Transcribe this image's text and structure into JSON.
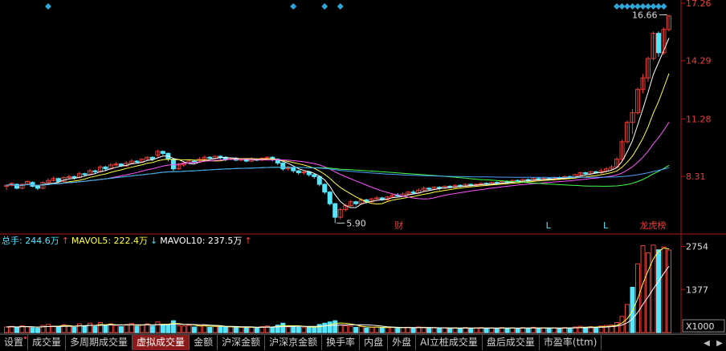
{
  "price_axis": {
    "ticks": [
      "17.26",
      "14.29",
      "11.28",
      "8.31"
    ]
  },
  "volume_axis": {
    "ticks": [
      "2754",
      "1377"
    ],
    "unit": "X1000"
  },
  "annotations": {
    "high_price": "16.66",
    "low_price": "5.90",
    "event_markers": [
      "财",
      "L",
      "L",
      "龙虎榜"
    ]
  },
  "volume_indicator": {
    "total_label": "总手: 244.6万",
    "mavol5_label": "MAVOL5: 222.4万",
    "mavol10_label": "MAVOL10: 237.5万"
  },
  "tabs": [
    {
      "label": "设置"
    },
    {
      "label": "成交量"
    },
    {
      "label": "多周期成交量"
    },
    {
      "label": "虚拟成交量"
    },
    {
      "label": "金额"
    },
    {
      "label": "沪深金额"
    },
    {
      "label": "沪深京金额"
    },
    {
      "label": "换手率"
    },
    {
      "label": "内盘"
    },
    {
      "label": "外盘"
    },
    {
      "label": "AI立桩成交量"
    },
    {
      "label": "盘后成交量"
    },
    {
      "label": "市盈率(ttm)"
    }
  ],
  "active_tab": "虚拟成交量",
  "colors": {
    "up": "#e8403a",
    "down": "#55e6ff",
    "axis": "#b01818",
    "ma5": "#ffffff",
    "ma10": "#ffff44",
    "ma20": "#ff55ff",
    "ma60": "#44ff44",
    "ma120": "#4aa3ff",
    "marker": "#2fa6d8"
  },
  "chart_data": {
    "type": "candlestick",
    "ylim": [
      5.5,
      17.26
    ],
    "volume_ylim": [
      0,
      3000
    ],
    "candles": [
      [
        7.8,
        7.85,
        7.6,
        7.9
      ],
      [
        7.85,
        7.95,
        7.8,
        8.0
      ],
      [
        7.9,
        7.7,
        7.65,
        7.95
      ],
      [
        7.7,
        7.9,
        7.65,
        7.95
      ],
      [
        7.9,
        8.05,
        7.85,
        8.1
      ],
      [
        8.0,
        7.8,
        7.75,
        8.05
      ],
      [
        7.8,
        7.7,
        7.6,
        7.85
      ],
      [
        7.7,
        8.0,
        7.65,
        8.05
      ],
      [
        8.0,
        8.1,
        7.95,
        8.2
      ],
      [
        8.1,
        8.2,
        8.05,
        8.3
      ],
      [
        8.2,
        8.05,
        8.0,
        8.25
      ],
      [
        8.05,
        8.25,
        8.0,
        8.3
      ],
      [
        8.25,
        8.3,
        8.2,
        8.4
      ],
      [
        8.3,
        8.25,
        8.15,
        8.35
      ],
      [
        8.25,
        8.45,
        8.2,
        8.55
      ],
      [
        8.45,
        8.4,
        8.3,
        8.5
      ],
      [
        8.4,
        8.6,
        8.35,
        8.7
      ],
      [
        8.6,
        8.55,
        8.45,
        8.65
      ],
      [
        8.55,
        8.8,
        8.5,
        8.9
      ],
      [
        8.8,
        8.7,
        8.6,
        8.85
      ],
      [
        8.7,
        8.9,
        8.65,
        9.0
      ],
      [
        8.9,
        8.95,
        8.85,
        9.05
      ],
      [
        8.95,
        8.85,
        8.8,
        9.0
      ],
      [
        8.85,
        9.0,
        8.8,
        9.1
      ],
      [
        9.0,
        9.1,
        8.95,
        9.2
      ],
      [
        9.1,
        9.05,
        9.0,
        9.15
      ],
      [
        9.05,
        9.2,
        9.0,
        9.25
      ],
      [
        9.2,
        9.3,
        9.15,
        9.35
      ],
      [
        9.3,
        9.2,
        9.1,
        9.35
      ],
      [
        9.4,
        9.6,
        9.3,
        9.7
      ],
      [
        9.6,
        9.5,
        9.4,
        9.65
      ],
      [
        9.5,
        9.2,
        9.1,
        9.55
      ],
      [
        9.2,
        8.7,
        8.6,
        9.25
      ],
      [
        8.7,
        8.9,
        8.65,
        9.0
      ],
      [
        8.9,
        9.0,
        8.8,
        9.1
      ],
      [
        9.0,
        9.1,
        8.95,
        9.2
      ],
      [
        9.1,
        9.05,
        8.95,
        9.15
      ],
      [
        9.05,
        9.2,
        9.0,
        9.3
      ],
      [
        9.2,
        9.3,
        9.15,
        9.4
      ],
      [
        9.3,
        9.25,
        9.2,
        9.35
      ],
      [
        9.25,
        9.35,
        9.2,
        9.4
      ],
      [
        9.35,
        9.3,
        9.2,
        9.4
      ],
      [
        9.3,
        9.2,
        9.1,
        9.35
      ],
      [
        9.2,
        9.25,
        9.15,
        9.3
      ],
      [
        9.25,
        9.15,
        9.1,
        9.3
      ],
      [
        9.15,
        9.2,
        9.1,
        9.25
      ],
      [
        9.2,
        9.1,
        9.05,
        9.25
      ],
      [
        9.1,
        9.2,
        9.05,
        9.3
      ],
      [
        9.2,
        9.15,
        9.1,
        9.25
      ],
      [
        9.15,
        9.25,
        9.1,
        9.3
      ],
      [
        9.25,
        9.3,
        9.2,
        9.35
      ],
      [
        9.3,
        9.2,
        9.1,
        9.35
      ],
      [
        9.2,
        9.0,
        8.9,
        9.25
      ],
      [
        9.0,
        8.7,
        8.6,
        9.05
      ],
      [
        8.7,
        8.75,
        8.6,
        8.85
      ],
      [
        8.75,
        8.6,
        8.5,
        8.8
      ],
      [
        8.6,
        8.5,
        8.4,
        8.65
      ],
      [
        8.5,
        8.55,
        8.4,
        8.6
      ],
      [
        8.55,
        8.4,
        8.3,
        8.6
      ],
      [
        8.4,
        8.3,
        8.2,
        8.45
      ],
      [
        8.3,
        7.9,
        7.8,
        8.35
      ],
      [
        7.9,
        7.5,
        7.4,
        7.95
      ],
      [
        7.5,
        6.9,
        6.8,
        7.55
      ],
      [
        6.9,
        6.2,
        5.9,
        6.95
      ],
      [
        6.2,
        6.6,
        6.1,
        6.7
      ],
      [
        6.6,
        6.8,
        6.5,
        6.9
      ],
      [
        6.8,
        7.0,
        6.75,
        7.1
      ],
      [
        7.0,
        6.9,
        6.8,
        7.05
      ],
      [
        6.9,
        7.1,
        6.85,
        7.2
      ],
      [
        7.1,
        7.0,
        6.9,
        7.15
      ],
      [
        7.0,
        7.15,
        6.95,
        7.2
      ],
      [
        7.15,
        7.2,
        7.1,
        7.3
      ],
      [
        7.2,
        7.1,
        7.05,
        7.25
      ],
      [
        7.1,
        7.25,
        7.05,
        7.3
      ],
      [
        7.25,
        7.35,
        7.2,
        7.4
      ],
      [
        7.35,
        7.3,
        7.25,
        7.45
      ],
      [
        7.3,
        7.4,
        7.25,
        7.5
      ],
      [
        7.4,
        7.5,
        7.35,
        7.55
      ],
      [
        7.5,
        7.45,
        7.4,
        7.6
      ],
      [
        7.45,
        7.6,
        7.4,
        7.7
      ],
      [
        7.6,
        7.7,
        7.55,
        7.8
      ],
      [
        7.7,
        7.65,
        7.6,
        7.75
      ],
      [
        7.65,
        7.75,
        7.6,
        7.8
      ],
      [
        7.75,
        7.7,
        7.6,
        7.8
      ],
      [
        7.7,
        7.8,
        7.65,
        7.85
      ],
      [
        7.8,
        7.75,
        7.7,
        7.85
      ],
      [
        7.75,
        7.85,
        7.7,
        7.9
      ],
      [
        7.85,
        7.8,
        7.75,
        7.9
      ],
      [
        7.8,
        7.9,
        7.75,
        7.95
      ],
      [
        7.9,
        7.85,
        7.8,
        7.95
      ],
      [
        7.85,
        7.9,
        7.8,
        7.95
      ],
      [
        7.9,
        7.95,
        7.85,
        8.0
      ],
      [
        7.95,
        7.9,
        7.85,
        8.0
      ],
      [
        7.9,
        8.0,
        7.85,
        8.05
      ],
      [
        8.0,
        7.95,
        7.9,
        8.05
      ],
      [
        7.95,
        8.05,
        7.9,
        8.1
      ],
      [
        8.05,
        8.0,
        7.95,
        8.1
      ],
      [
        8.0,
        8.1,
        7.95,
        8.15
      ],
      [
        8.1,
        8.05,
        8.0,
        8.15
      ],
      [
        8.05,
        8.15,
        8.0,
        8.2
      ],
      [
        8.15,
        8.1,
        8.05,
        8.2
      ],
      [
        8.1,
        8.2,
        8.05,
        8.25
      ],
      [
        8.2,
        8.15,
        8.1,
        8.25
      ],
      [
        8.15,
        8.2,
        8.1,
        8.25
      ],
      [
        8.2,
        8.15,
        8.1,
        8.25
      ],
      [
        8.15,
        8.25,
        8.1,
        8.3
      ],
      [
        8.25,
        8.2,
        8.15,
        8.3
      ],
      [
        8.2,
        8.3,
        8.15,
        8.35
      ],
      [
        8.3,
        8.25,
        8.2,
        8.35
      ],
      [
        8.25,
        8.4,
        8.2,
        8.45
      ],
      [
        8.4,
        8.5,
        8.35,
        8.55
      ],
      [
        8.5,
        8.45,
        8.4,
        8.55
      ],
      [
        8.45,
        8.55,
        8.4,
        8.6
      ],
      [
        8.55,
        8.5,
        8.45,
        8.6
      ],
      [
        8.5,
        8.6,
        8.45,
        8.7
      ],
      [
        8.6,
        8.7,
        8.55,
        8.8
      ],
      [
        8.7,
        8.8,
        8.65,
        8.9
      ],
      [
        8.8,
        9.2,
        8.75,
        9.3
      ],
      [
        9.2,
        10.1,
        9.1,
        10.2
      ],
      [
        10.1,
        11.1,
        10.0,
        11.2
      ],
      [
        11.1,
        11.6,
        10.5,
        11.8
      ],
      [
        11.6,
        12.8,
        11.5,
        12.9
      ],
      [
        12.8,
        13.4,
        12.6,
        13.6
      ],
      [
        13.4,
        14.4,
        13.2,
        14.5
      ],
      [
        14.4,
        15.7,
        14.3,
        15.8
      ],
      [
        15.7,
        14.7,
        14.5,
        15.8
      ],
      [
        14.7,
        15.9,
        14.6,
        16.0
      ],
      [
        15.9,
        16.6,
        15.8,
        16.66
      ]
    ],
    "volumes": [
      [
        180,
        1
      ],
      [
        200,
        1
      ],
      [
        160,
        0
      ],
      [
        220,
        1
      ],
      [
        190,
        1
      ],
      [
        150,
        0
      ],
      [
        140,
        0
      ],
      [
        230,
        1
      ],
      [
        260,
        1
      ],
      [
        210,
        1
      ],
      [
        180,
        0
      ],
      [
        250,
        1
      ],
      [
        220,
        1
      ],
      [
        170,
        0
      ],
      [
        280,
        1
      ],
      [
        200,
        0
      ],
      [
        300,
        1
      ],
      [
        190,
        0
      ],
      [
        320,
        1
      ],
      [
        240,
        0
      ],
      [
        280,
        1
      ],
      [
        230,
        1
      ],
      [
        190,
        0
      ],
      [
        260,
        1
      ],
      [
        290,
        1
      ],
      [
        200,
        0
      ],
      [
        250,
        1
      ],
      [
        280,
        1
      ],
      [
        210,
        0
      ],
      [
        340,
        1
      ],
      [
        250,
        0
      ],
      [
        260,
        0
      ],
      [
        380,
        0
      ],
      [
        220,
        1
      ],
      [
        210,
        1
      ],
      [
        230,
        1
      ],
      [
        180,
        0
      ],
      [
        220,
        1
      ],
      [
        240,
        1
      ],
      [
        170,
        0
      ],
      [
        200,
        1
      ],
      [
        180,
        0
      ],
      [
        170,
        0
      ],
      [
        190,
        1
      ],
      [
        160,
        0
      ],
      [
        170,
        1
      ],
      [
        150,
        0
      ],
      [
        180,
        1
      ],
      [
        160,
        0
      ],
      [
        190,
        1
      ],
      [
        210,
        1
      ],
      [
        170,
        0
      ],
      [
        240,
        0
      ],
      [
        300,
        0
      ],
      [
        180,
        1
      ],
      [
        200,
        0
      ],
      [
        170,
        0
      ],
      [
        160,
        1
      ],
      [
        180,
        0
      ],
      [
        170,
        0
      ],
      [
        260,
        0
      ],
      [
        300,
        0
      ],
      [
        340,
        0
      ],
      [
        380,
        0
      ],
      [
        250,
        1
      ],
      [
        220,
        1
      ],
      [
        200,
        1
      ],
      [
        170,
        0
      ],
      [
        190,
        1
      ],
      [
        150,
        0
      ],
      [
        170,
        1
      ],
      [
        180,
        1
      ],
      [
        150,
        0
      ],
      [
        160,
        1
      ],
      [
        170,
        1
      ],
      [
        140,
        0
      ],
      [
        160,
        1
      ],
      [
        170,
        1
      ],
      [
        140,
        0
      ],
      [
        180,
        1
      ],
      [
        170,
        1
      ],
      [
        140,
        0
      ],
      [
        150,
        1
      ],
      [
        130,
        0
      ],
      [
        150,
        1
      ],
      [
        130,
        0
      ],
      [
        150,
        1
      ],
      [
        140,
        0
      ],
      [
        160,
        1
      ],
      [
        130,
        0
      ],
      [
        150,
        1
      ],
      [
        160,
        1
      ],
      [
        130,
        0
      ],
      [
        150,
        1
      ],
      [
        130,
        0
      ],
      [
        160,
        1
      ],
      [
        140,
        0
      ],
      [
        150,
        1
      ],
      [
        130,
        0
      ],
      [
        160,
        1
      ],
      [
        140,
        0
      ],
      [
        170,
        1
      ],
      [
        130,
        0
      ],
      [
        150,
        1
      ],
      [
        140,
        0
      ],
      [
        150,
        1
      ],
      [
        130,
        0
      ],
      [
        160,
        1
      ],
      [
        150,
        0
      ],
      [
        180,
        1
      ],
      [
        200,
        1
      ],
      [
        170,
        0
      ],
      [
        190,
        1
      ],
      [
        160,
        0
      ],
      [
        210,
        1
      ],
      [
        230,
        1
      ],
      [
        240,
        1
      ],
      [
        320,
        1
      ],
      [
        520,
        1
      ],
      [
        900,
        1
      ],
      [
        1450,
        0
      ],
      [
        2200,
        1
      ],
      [
        2780,
        1
      ],
      [
        2550,
        1
      ],
      [
        2800,
        1
      ],
      [
        2650,
        0
      ],
      [
        2740,
        1
      ],
      [
        2640,
        1
      ]
    ]
  }
}
